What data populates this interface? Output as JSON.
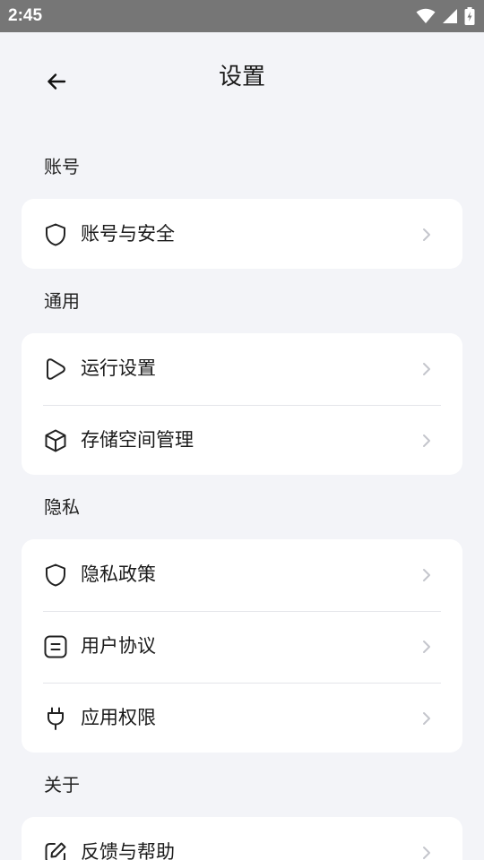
{
  "status_bar": {
    "time": "2:45"
  },
  "header": {
    "title": "设置"
  },
  "sections": [
    {
      "label": "账号",
      "items": [
        {
          "label": "账号与安全",
          "icon": "shield-icon"
        }
      ]
    },
    {
      "label": "通用",
      "items": [
        {
          "label": "运行设置",
          "icon": "play-icon"
        },
        {
          "label": "存储空间管理",
          "icon": "box-icon"
        }
      ]
    },
    {
      "label": "隐私",
      "items": [
        {
          "label": "隐私政策",
          "icon": "shield-icon"
        },
        {
          "label": "用户协议",
          "icon": "document-icon"
        },
        {
          "label": "应用权限",
          "icon": "plug-icon"
        }
      ]
    },
    {
      "label": "关于",
      "items": [
        {
          "label": "反馈与帮助",
          "icon": "edit-icon"
        }
      ]
    }
  ]
}
